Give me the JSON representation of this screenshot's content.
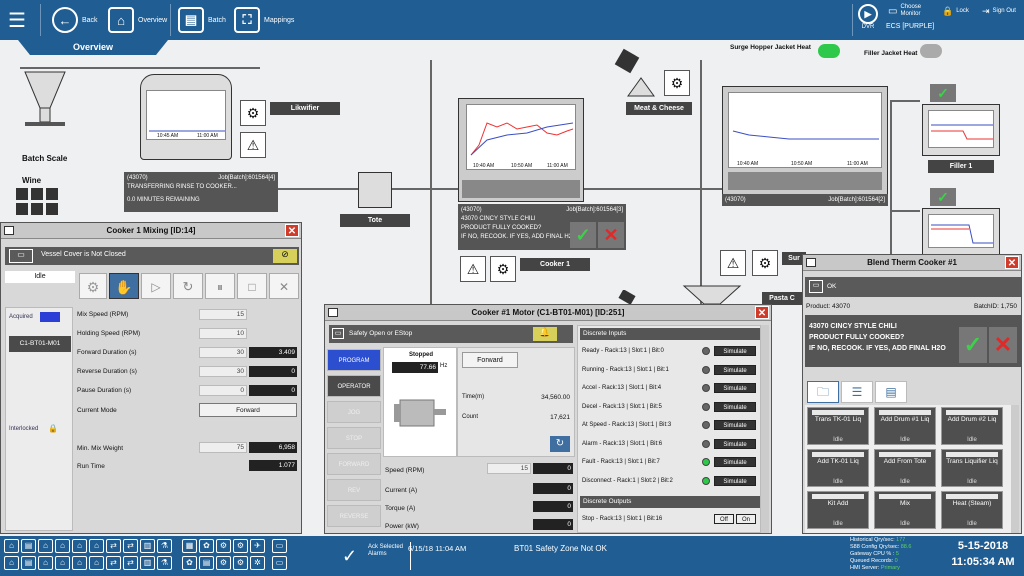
{
  "topbar": {
    "back": "Back",
    "overview": "Overview",
    "batch": "Batch",
    "mappings": "Mappings",
    "dvr": "DVR",
    "ecs": "ECS [PURPLE]",
    "choose_monitor": "Choose Monitor",
    "lock": "Lock",
    "sign_out": "Sign Out"
  },
  "overview_tab": "Overview",
  "process": {
    "batch_scale": "Batch Scale",
    "wine": "Wine",
    "likwifier": "Likwifier",
    "tote": "Tote",
    "meat_cheese": "Meat & Cheese",
    "cooker1": "Cooker 1",
    "filler1": "Filler 1",
    "surge_hopper": "Surge Hopper Jacket Heat",
    "filler_jacket": "Filler Jacket Heat",
    "pasta_partial": "Pasta C",
    "sur_partial": "Sur",
    "trend1_times": [
      "10:45 AM",
      "11:00 AM"
    ],
    "trend2_times": [
      "10:40 AM",
      "10:50 AM",
      "11:00 AM"
    ],
    "trend3_times": [
      "10:40 AM",
      "10:50 AM",
      "11:00 AM"
    ],
    "info1": [
      "(43070)",
      "Job[Batch]:601564[4]",
      "TRANSFERRING RINSE TO COOKER...",
      "0.0 MINUTES REMAINING"
    ],
    "info2": [
      "(43070)",
      "Job[Batch]:601564[3]",
      "43070 CINCY STYLE CHILI",
      "PRODUCT FULLY COOKED?",
      "IF NO, RECOOK. IF YES, ADD FINAL H2O"
    ],
    "info3": [
      "(43070)",
      "Job[Batch]:601564[2]"
    ]
  },
  "mixing": {
    "title": "Cooker 1 Mixing [ID:14]",
    "warning": "Vessel Cover is Not Closed",
    "state": "Idle",
    "acquired": "Acquired",
    "device": "C1-BT01-M01",
    "interlocked": "Interlocked",
    "rows": [
      {
        "label": "Mix Speed (RPM)",
        "set": "15",
        "act": ""
      },
      {
        "label": "Holding Speed (RPM)",
        "set": "10",
        "act": ""
      },
      {
        "label": "Forward Duration (s)",
        "set": "30",
        "act": "3.409"
      },
      {
        "label": "Reverse Duration (s)",
        "set": "30",
        "act": "0"
      },
      {
        "label": "Pause Duration (s)",
        "set": "0",
        "act": "0"
      }
    ],
    "current_mode_label": "Current Mode",
    "current_mode": "Forward",
    "min_mix_weight_label": "Min. Mix Weight",
    "min_mix_weight_set": "75",
    "min_mix_weight_act": "6,958",
    "run_time_label": "Run Time",
    "run_time": "1.077"
  },
  "motor": {
    "title": "Cooker #1 Motor (C1-BT01-M01) [ID:251]",
    "safety": "Safety Open or EStop",
    "modes": [
      "PROGRAM",
      "OPERATOR",
      "JOG",
      "STOP",
      "FORWARD",
      "REV",
      "REVERSE"
    ],
    "stopped": "Stopped",
    "hz_value": "77.66",
    "hz_unit": "Hz",
    "forward": "Forward",
    "time_label": "Time(m)",
    "time_value": "34,560.00",
    "count_label": "Count",
    "count_value": "17,621",
    "speed_label": "Speed (RPM)",
    "speed_set": "15",
    "speed_act": "0",
    "current_label": "Current (A)",
    "current_act": "0",
    "torque_label": "Torque (A)",
    "torque_act": "0",
    "power_label": "Power (kW)",
    "power_act": "0",
    "discrete_inputs": "Discrete Inputs",
    "inputs": [
      {
        "label": "Ready - Rack:13 | Slot:1 | Bit:0",
        "on": false
      },
      {
        "label": "Running - Rack:13 | Slot:1 | Bit:1",
        "on": false
      },
      {
        "label": "Accel - Rack:13 | Slot:1 | Bit:4",
        "on": false
      },
      {
        "label": "Decel - Rack:13 | Slot:1 | Bit:5",
        "on": false
      },
      {
        "label": "At Speed - Rack:13 | Slot:1 | Bit:3",
        "on": false
      },
      {
        "label": "Alarm - Rack:13 | Slot:1 | Bit:6",
        "on": false
      },
      {
        "label": "Fault - Rack:13 | Slot:1 | Bit:7",
        "on": true
      },
      {
        "label": "Disconnect - Rack:1 | Slot:2 | Bit:2",
        "on": true
      }
    ],
    "simulate": "Simulate",
    "discrete_outputs": "Discrete Outputs",
    "output_label": "Stop - Rack:13 | Slot:1 | Bit:16",
    "off": "Off",
    "on": "On"
  },
  "blend": {
    "title": "Blend Therm Cooker #1",
    "ok": "OK",
    "product": "Product: 43070",
    "batch_id": "BatchID: 1,750",
    "message": [
      "43070 CINCY STYLE CHILI",
      "PRODUCT FULLY COOKED?",
      "IF NO, RECOOK. IF YES, ADD FINAL H2O"
    ],
    "buttons": [
      {
        "label": "Trans TK-01 Liq",
        "status": "Idle"
      },
      {
        "label": "Add Drum #1 Liq",
        "status": "Idle"
      },
      {
        "label": "Add Drum #2 Liq",
        "status": "Idle"
      },
      {
        "label": "Add TK-01 Liq",
        "status": "Idle"
      },
      {
        "label": "Add From Tote",
        "status": "Idle"
      },
      {
        "label": "Trans Liquifier Liq",
        "status": "Idle"
      },
      {
        "label": "Kit Add",
        "status": "Idle"
      },
      {
        "label": "Mix",
        "status": "Idle"
      },
      {
        "label": "Heat (Steam)",
        "status": "Idle"
      }
    ]
  },
  "bottombar": {
    "ack": "Ack Selected Alarms",
    "alarm_time": "6/15/18 11:04 AM",
    "alarm_text": "BT01 Safety Zone Not OK",
    "stats": [
      {
        "label": "Historical Qry/sec:",
        "value": "177"
      },
      {
        "label": "S88 Config Qry/sec:",
        "value": "88.6"
      },
      {
        "label": "Gateway CPU % :",
        "value": "5"
      },
      {
        "label": "Queued Records:",
        "value": "0"
      },
      {
        "label": "HMI Server:",
        "value": "Primary"
      }
    ],
    "date": "5-15-2018",
    "time": "11:05:34 AM"
  },
  "colors": {
    "primary": "#1f5d92",
    "alarm_red": "#d23a2a",
    "ok_green": "#2ec84a"
  }
}
